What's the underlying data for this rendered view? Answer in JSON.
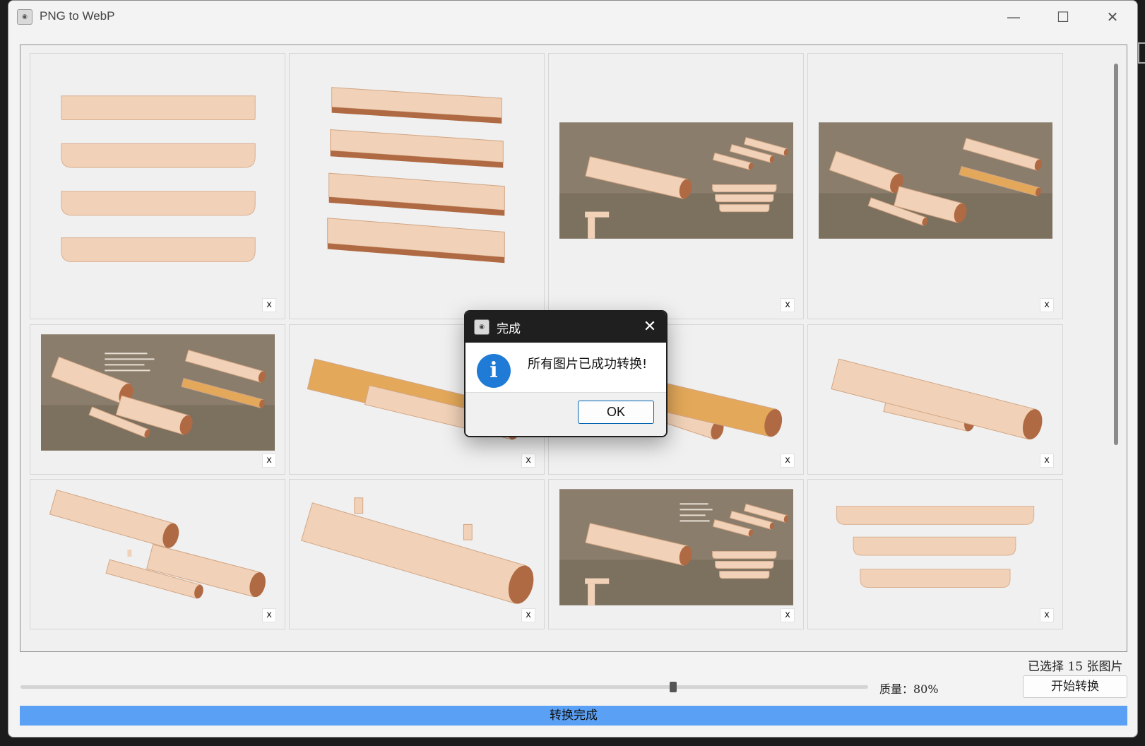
{
  "window": {
    "title": "PNG to WebP",
    "icon": "app-logo-icon",
    "controls": [
      "minimize-icon",
      "maximize-icon",
      "close-icon"
    ]
  },
  "gallery": {
    "remove_label": "x",
    "thumbnails": [
      {
        "kind": "stacked-boards",
        "show_remove": true
      },
      {
        "kind": "angled-boards",
        "show_remove": false
      },
      {
        "kind": "diagram-boards",
        "show_remove": true
      },
      {
        "kind": "diagram-logs",
        "show_remove": true
      },
      {
        "kind": "diagram-logs-annotated",
        "show_remove": true
      },
      {
        "kind": "log-orange-left",
        "show_remove": true
      },
      {
        "kind": "log-orange-right",
        "show_remove": true
      },
      {
        "kind": "log-assembled",
        "show_remove": true
      },
      {
        "kind": "log-exploded",
        "show_remove": true
      },
      {
        "kind": "beam-pegs",
        "show_remove": true
      },
      {
        "kind": "diagram-boards-annotated",
        "show_remove": true
      },
      {
        "kind": "stacked-boards-3",
        "show_remove": true
      }
    ]
  },
  "status": {
    "selected_count": "已选择 15 张图片"
  },
  "quality": {
    "label": "质量：80%",
    "value": 0.77
  },
  "start_button": {
    "label": "开始转换"
  },
  "progress": {
    "value": 1.0,
    "label": "转换完成"
  },
  "dialog": {
    "title": "完成",
    "message": "所有图片已成功转换!",
    "ok_label": "OK",
    "icon": "info-icon"
  },
  "colors": {
    "accent": "#5aa0f5",
    "wood_light": "#f1d2b8",
    "wood_dark": "#b06a43",
    "diagram_bg": "#8a7d6c"
  }
}
